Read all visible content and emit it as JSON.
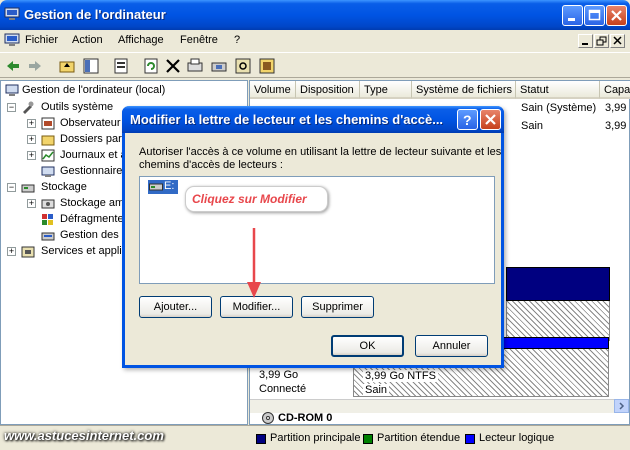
{
  "window": {
    "title": "Gestion de l'ordinateur"
  },
  "menu": {
    "items": [
      "Fichier",
      "Action",
      "Affichage",
      "Fenêtre",
      "?"
    ]
  },
  "tree": {
    "root": "Gestion de l'ordinateur (local)",
    "items": [
      {
        "label": "Outils système"
      },
      {
        "label": "Observateur"
      },
      {
        "label": "Dossiers part"
      },
      {
        "label": "Journaux et a"
      },
      {
        "label": "Gestionnaire"
      },
      {
        "label": "Stockage"
      },
      {
        "label": "Stockage amo"
      },
      {
        "label": "Défragmente"
      },
      {
        "label": "Gestion des d"
      },
      {
        "label": "Services et applic"
      }
    ]
  },
  "volumes": {
    "columns": [
      "Volume",
      "Disposition",
      "Type",
      "Système de fichiers",
      "Statut",
      "Capa"
    ],
    "rows": [
      {
        "status": "Sain (Système)",
        "capacity": "3,99"
      },
      {
        "status": "Sain",
        "capacity": "3,99"
      }
    ]
  },
  "disk": {
    "size": "3,99 Go",
    "state": "Connecté",
    "partition_size": "3,99 Go NTFS",
    "partition_status": "Sain",
    "cdrom": "CD-ROM 0"
  },
  "legend": [
    {
      "label": "Partition principale",
      "color": "#000080"
    },
    {
      "label": "Partition étendue",
      "color": "#008000"
    },
    {
      "label": "Lecteur logique",
      "color": "#0000ff"
    }
  ],
  "watermark": "www.astucesinternet.com",
  "dialog": {
    "title": "Modifier la lettre de lecteur et les chemins d'accè...",
    "description_line1": "Autoriser l'accès à ce volume en utilisant la lettre de lecteur suivante et les",
    "description_line2": "chemins d'accès de lecteurs :",
    "drive_letter": "E:",
    "buttons": {
      "add": "Ajouter...",
      "modify": "Modifier...",
      "delete": "Supprimer",
      "ok": "OK",
      "cancel": "Annuler"
    }
  },
  "callout": {
    "text": "Cliquez sur Modifier",
    "color": "#e8474c"
  }
}
